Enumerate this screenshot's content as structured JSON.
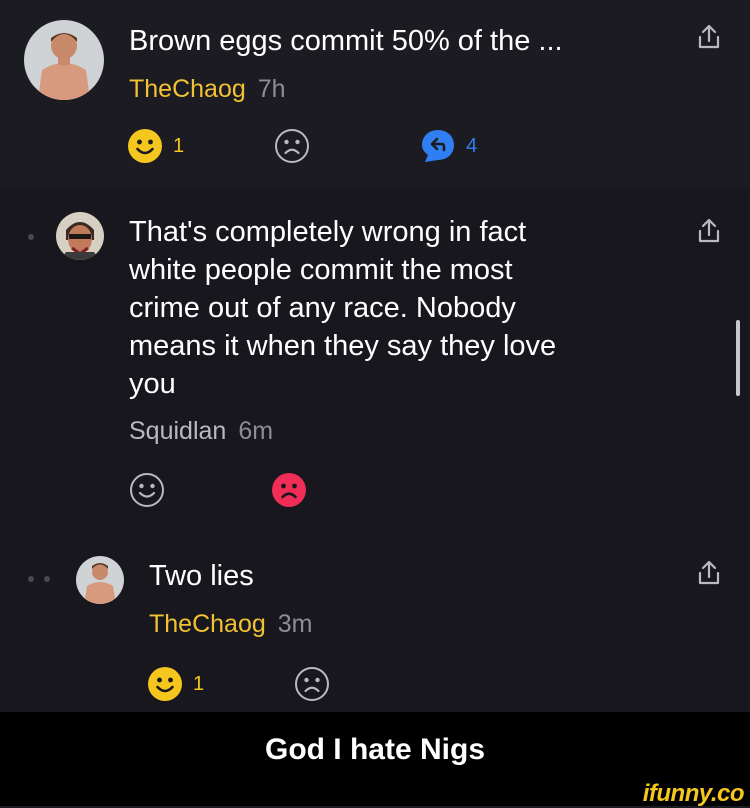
{
  "comments": [
    {
      "text": "Brown eggs commit 50% of the ...",
      "user": "TheChaog",
      "time": "7h",
      "smile_count": "1",
      "reply_count": "4"
    },
    {
      "text_lines": [
        "That's completely wrong in fact",
        "white people commit the most",
        "crime out of any race. Nobody",
        "means it when they say they love",
        "you"
      ],
      "user": "Squidlan",
      "time": "6m"
    },
    {
      "text": "Two lies",
      "user": "TheChaog",
      "time": "3m",
      "smile_count": "1"
    }
  ],
  "caption": "God I hate Nigs",
  "watermark": "ifunny.co",
  "colors": {
    "background": "#1c1b22",
    "username": "#f1c232",
    "smile_active": "#f4c61e",
    "frown_active": "#ef2d56",
    "reply_bubble": "#2f7ff2",
    "icon_outline": "#b9b9bf"
  },
  "icons": [
    "avatar",
    "share-icon",
    "smile-icon",
    "frown-icon",
    "reply-bubble-icon"
  ]
}
